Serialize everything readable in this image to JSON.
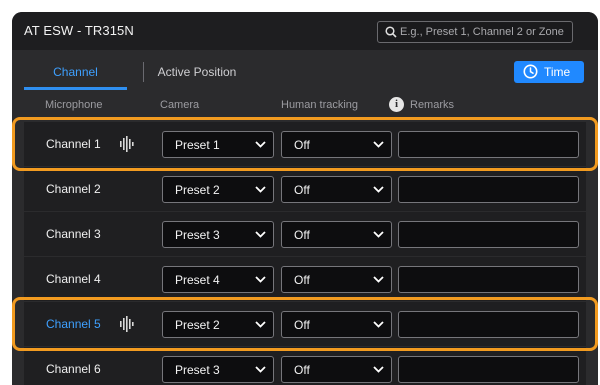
{
  "app": {
    "title": "AT ESW - TR315N"
  },
  "search": {
    "placeholder": "E.g., Preset 1, Channel 2 or Zone"
  },
  "tabs": [
    {
      "label": "Channel",
      "active": true
    },
    {
      "label": "Active Position",
      "active": false
    }
  ],
  "time_button": {
    "label": "Time",
    "icon": "clock-icon"
  },
  "columns": {
    "microphone": "Microphone",
    "camera": "Camera",
    "tracking": "Human tracking",
    "info": "i",
    "remarks": "Remarks"
  },
  "rows": [
    {
      "channel": "Channel 1",
      "camera": "Preset 1",
      "tracking": "Off",
      "remarks": "",
      "active": true,
      "label_color": "#f0f0f0"
    },
    {
      "channel": "Channel 2",
      "camera": "Preset 2",
      "tracking": "Off",
      "remarks": "",
      "active": false,
      "label_color": "#f0f0f0"
    },
    {
      "channel": "Channel 3",
      "camera": "Preset 3",
      "tracking": "Off",
      "remarks": "",
      "active": false,
      "label_color": "#f0f0f0"
    },
    {
      "channel": "Channel 4",
      "camera": "Preset 4",
      "tracking": "Off",
      "remarks": "",
      "active": false,
      "label_color": "#f0f0f0"
    },
    {
      "channel": "Channel 5",
      "camera": "Preset 2",
      "tracking": "Off",
      "remarks": "",
      "active": true,
      "label_color": "#3ea0ff"
    },
    {
      "channel": "Channel 6",
      "camera": "Preset 3",
      "tracking": "Off",
      "remarks": "",
      "active": false,
      "label_color": "#f0f0f0"
    }
  ],
  "colors": {
    "accent": "#2089ff",
    "highlight": "#f29b20",
    "background": "#2b2b2d"
  }
}
